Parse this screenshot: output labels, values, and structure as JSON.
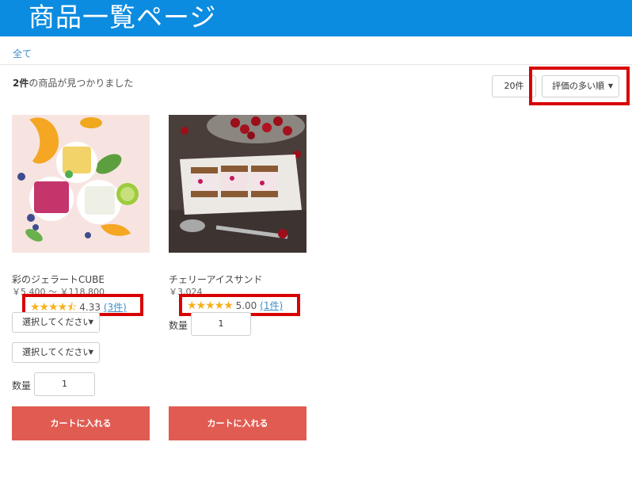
{
  "header": {
    "title": "商品一覧ページ"
  },
  "breadcrumb": {
    "label": "全て"
  },
  "results": {
    "count": "2件",
    "suffix": "の商品が見つかりました"
  },
  "controls": {
    "page_size": "20件",
    "sort": "評価の多い順"
  },
  "products": [
    {
      "name": "彩のジェラートCUBE",
      "price": "￥5,400 ～ ￥118,800",
      "rating_stars": "★★★★⯪",
      "rating_value": "4.33",
      "review_count": "(3件)",
      "variant1": "選択してください",
      "variant2": "選択してください",
      "quantity_label": "数量",
      "quantity": "1",
      "cart_label": "カートに入れる"
    },
    {
      "name": "チェリーアイスサンド",
      "price": "￥3,024",
      "rating_stars": "★★★★★",
      "rating_value": "5.00",
      "review_count": "(1件)",
      "quantity_label": "数量",
      "quantity": "1",
      "cart_label": "カートに入れる"
    }
  ],
  "colors": {
    "header": "#0c8ce0",
    "cart_button": "#e05c52",
    "star": "#f6b11a",
    "highlight": "#d90000"
  }
}
